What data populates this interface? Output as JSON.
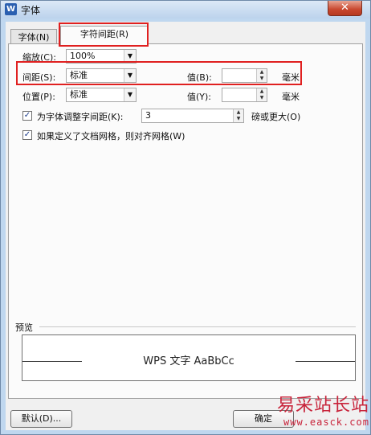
{
  "window": {
    "title": "字体",
    "app_icon": "W",
    "close_glyph": "✕"
  },
  "tabs": [
    {
      "label": "字体(N)"
    },
    {
      "label": "字符间距(R)"
    }
  ],
  "scale": {
    "label": "缩放(C):",
    "value": "100%"
  },
  "spacing": {
    "label": "间距(S):",
    "value": "标准",
    "value_label": "值(B):",
    "amount": "",
    "unit": "毫米"
  },
  "position": {
    "label": "位置(P):",
    "value": "标准",
    "value_label": "值(Y):",
    "amount": "",
    "unit": "毫米"
  },
  "kerning": {
    "checked": true,
    "label": "为字体调整字间距(K):",
    "amount": "3",
    "suffix": "磅或更大(O)"
  },
  "grid": {
    "checked": true,
    "label": "如果定义了文档网格，则对齐网格(W)"
  },
  "preview": {
    "label": "预览",
    "text": "WPS 文字 AaBbCc"
  },
  "buttons": {
    "default": "默认(D)...",
    "ok": "确定"
  },
  "watermark": {
    "text": "易采站长站",
    "url": "www.easck.com"
  },
  "colors": {
    "highlight": "#e02020",
    "watermark": "#c8233a"
  }
}
